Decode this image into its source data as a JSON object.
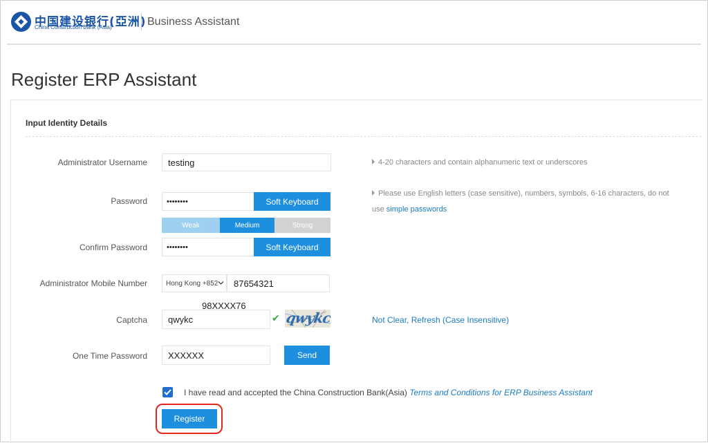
{
  "header": {
    "logo_cn": "中国建设银行(亞洲)",
    "logo_en": "China Construction Bank (Asia)",
    "app_name": "Business Assistant"
  },
  "page": {
    "title": "Register ERP Assistant",
    "section_title": "Input Identity Details"
  },
  "form": {
    "username": {
      "label": "Administrator Username",
      "value": "testing",
      "hint": "4-20 characters and contain alphanumeric text or underscores"
    },
    "password": {
      "label": "Password",
      "value": "••••••••",
      "soft_keyboard": "Soft Keyboard",
      "hint_line1": "Please use English letters (case sensitive), numbers, symbols, 6-16 characters, do not",
      "hint_line2_prefix": "use ",
      "hint_link": "simple passwords",
      "strength": {
        "weak": "Weak",
        "medium": "Medium",
        "strong": "Strong",
        "level": "Medium"
      }
    },
    "confirm_password": {
      "label": "Confirm Password",
      "value": "••••••••",
      "soft_keyboard": "Soft Keyboard"
    },
    "mobile": {
      "label": "Administrator Mobile Number",
      "country_code": "Hong Kong +852",
      "value": "87654321"
    },
    "captcha": {
      "label": "Captcha",
      "overlay_value": "98XXXX76",
      "value": "qwykc",
      "image_text": "qwykc",
      "refresh_link": "Not Clear, Refresh (Case Insensitive)"
    },
    "otp": {
      "label": "One Time Password",
      "value": "XXXXXX",
      "send_button": "Send"
    },
    "terms": {
      "checked": true,
      "text": "I have read and accepted the China Construction Bank(Asia) ",
      "link": "Terms and Conditions for ERP Business Assistant"
    },
    "register_button": "Register"
  },
  "colors": {
    "primary": "#1e8fdf",
    "brand": "#1b56a6",
    "highlight": "#e2241b",
    "valid": "#3ea34a"
  }
}
